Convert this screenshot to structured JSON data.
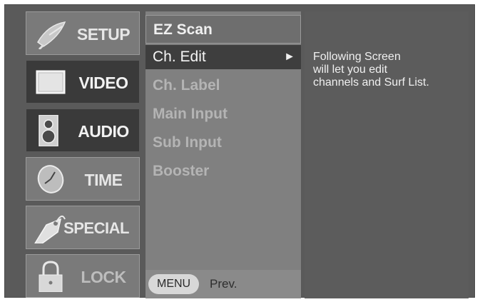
{
  "categories": [
    {
      "label": "SETUP",
      "icon": "satellite-dish-icon"
    },
    {
      "label": "VIDEO",
      "icon": "monitor-icon"
    },
    {
      "label": "AUDIO",
      "icon": "speaker-icon"
    },
    {
      "label": "TIME",
      "icon": "clock-icon"
    },
    {
      "label": "SPECIAL",
      "icon": "tag-icon"
    },
    {
      "label": "LOCK",
      "icon": "padlock-icon"
    }
  ],
  "submenu": {
    "items": [
      "EZ Scan",
      "Ch. Edit",
      "Ch. Label",
      "Main Input",
      "Sub Input",
      "Booster"
    ],
    "selected_arrow": "►"
  },
  "bottom": {
    "menu_label": "MENU",
    "prev_label": "Prev."
  },
  "info": {
    "lines": [
      "Following Screen",
      "will let you edit",
      "channels and Surf List."
    ]
  },
  "colors": {
    "panel": "#5c5c5c",
    "highlight": "#3e3e3e",
    "text": "#f0f0f0"
  }
}
